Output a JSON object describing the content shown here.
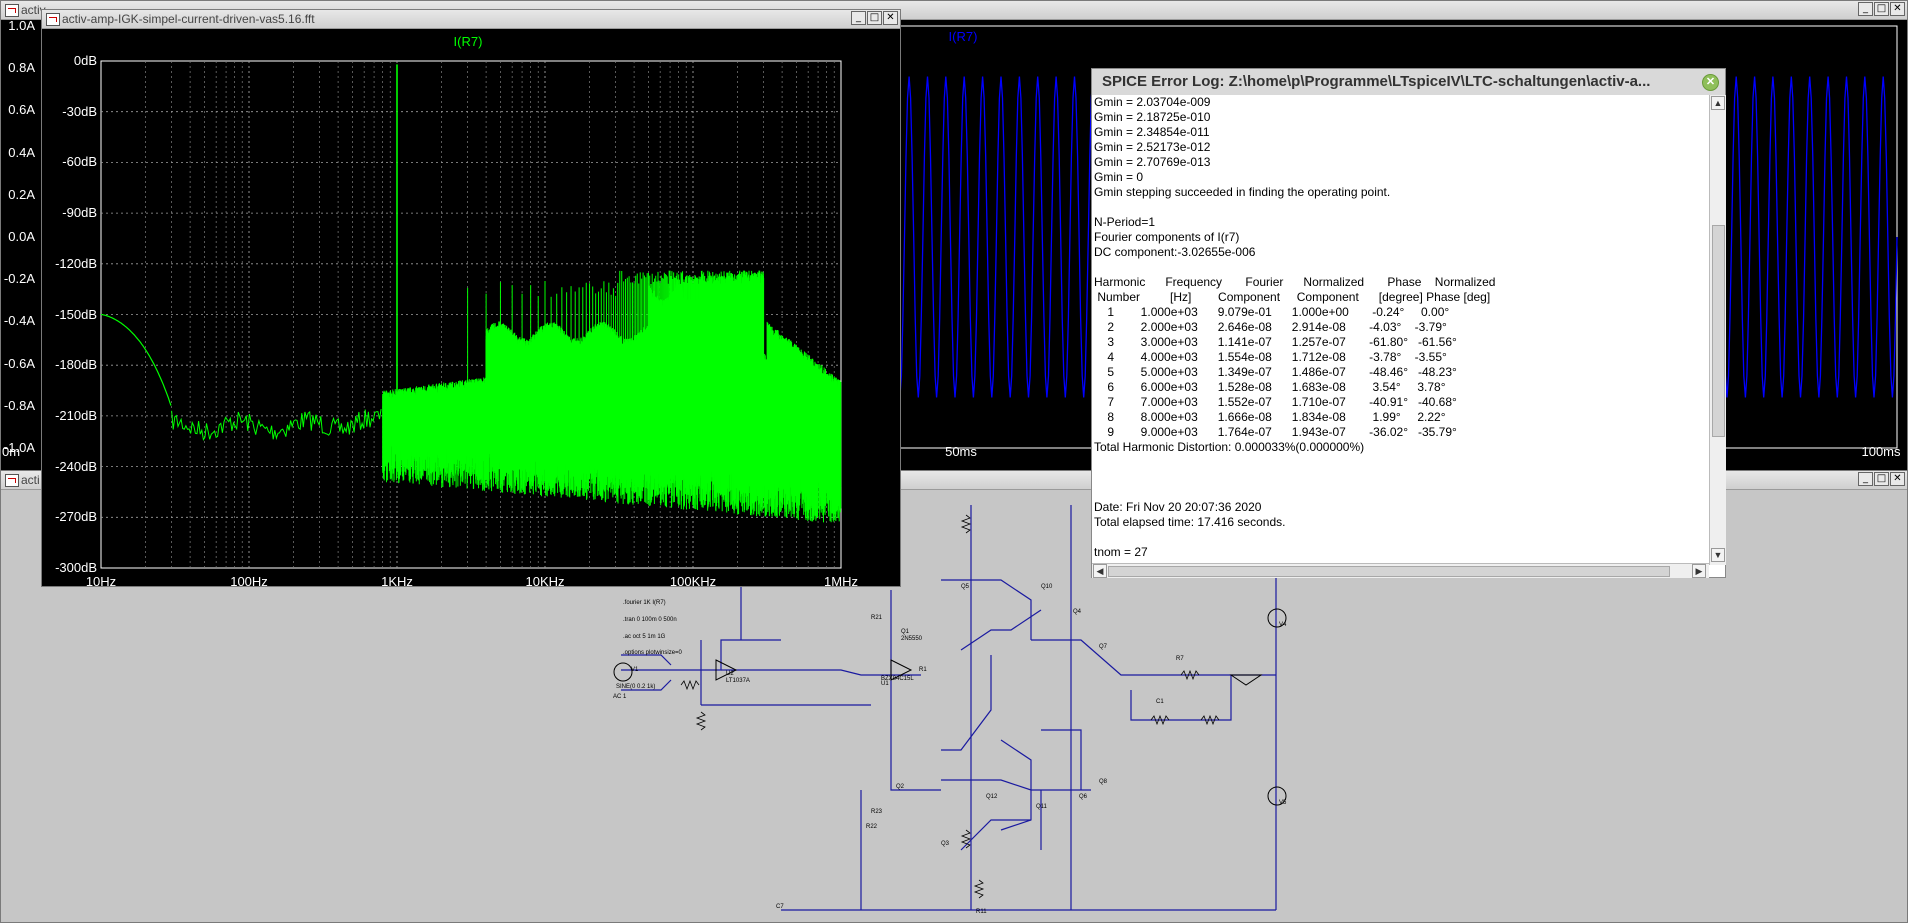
{
  "fft_window": {
    "title": "activ-amp-IGK-simpel-current-driven-vas5.16.fft",
    "trace_label": "I(R7)",
    "y_ticks": [
      "0dB",
      "-30dB",
      "-60dB",
      "-90dB",
      "-120dB",
      "-150dB",
      "-180dB",
      "-210dB",
      "-240dB",
      "-270dB",
      "-300dB"
    ],
    "x_ticks": [
      "10Hz",
      "100Hz",
      "1KHz",
      "10KHz",
      "100KHz",
      "1MHz"
    ],
    "trace_color": "#00ff00"
  },
  "time_window": {
    "title_fragment": "activ",
    "trace_label": "I(R7)",
    "y_ticks": [
      "1.0A",
      "0.8A",
      "0.6A",
      "0.4A",
      "0.2A",
      "0.0A",
      "-0.2A",
      "-0.4A",
      "-0.6A",
      "-0.8A",
      "-1.0A"
    ],
    "x_tick_start": "0m",
    "x_tick_mid": "50ms",
    "x_tick_end": "100ms",
    "trace_color": "#0000ff"
  },
  "schematic_window": {
    "title_fragment": "acti",
    "directives": [
      ".fourier 1K I(R7)",
      ".tran 0 100m 0 500n",
      ".ac oct 5 1m 1G",
      ".options plotwinsize=0"
    ],
    "parts": [
      "R21",
      "Q1",
      "2N5550",
      "R1",
      "R23",
      "U2",
      "LT1037A",
      "U1",
      "BZX84C15L",
      "V4",
      "V5",
      "Q5",
      "Q10",
      "Q4",
      "Q7",
      "R7",
      "C1",
      "Q2",
      "Q12",
      "Q3",
      "Q11",
      "Q6",
      "Q8",
      "R22",
      "R11",
      "C7",
      "V1",
      "SINE(0 0.2 1k)",
      "AC 1"
    ]
  },
  "error_log": {
    "title": "SPICE Error Log: Z:\\home\\p\\Programme\\LTspiceIV\\LTC-schaltungen\\activ-a...",
    "lines": [
      "Gmin = 2.03704e-009",
      "Gmin = 2.18725e-010",
      "Gmin = 2.34854e-011",
      "Gmin = 2.52173e-012",
      "Gmin = 2.70769e-013",
      "Gmin = 0",
      "Gmin stepping succeeded in finding the operating point.",
      "",
      "N-Period=1",
      "Fourier components of I(r7)",
      "DC component:-3.02655e-006",
      "",
      "Harmonic      Frequency       Fourier      Normalized       Phase    Normalized",
      " Number         [Hz]        Component     Component      [degree] Phase [deg]",
      "    1        1.000e+03      9.079e-01      1.000e+00       -0.24°     0.00°",
      "    2        2.000e+03      2.646e-08      2.914e-08       -4.03°    -3.79°",
      "    3        3.000e+03      1.141e-07      1.257e-07       -61.80°   -61.56°",
      "    4        4.000e+03      1.554e-08      1.712e-08       -3.78°    -3.55°",
      "    5        5.000e+03      1.349e-07      1.486e-07       -48.46°   -48.23°",
      "    6        6.000e+03      1.528e-08      1.683e-08        3.54°     3.78°",
      "    7        7.000e+03      1.552e-07      1.710e-07       -40.91°   -40.68°",
      "    8        8.000e+03      1.666e-08      1.834e-08        1.99°     2.22°",
      "    9        9.000e+03      1.764e-07      1.943e-07       -36.02°   -35.79°",
      "Total Harmonic Distortion: 0.000033%(0.000000%)",
      "",
      "",
      "",
      "Date: Fri Nov 20 20:07:36 2020",
      "Total elapsed time: 17.416 seconds.",
      "",
      "tnom = 27"
    ]
  },
  "window_buttons": {
    "minimize": "_",
    "maximize": "□",
    "close": "✕"
  },
  "icons": {
    "close_circle": "close-circle-icon",
    "scroll_up": "▲",
    "scroll_down": "▼",
    "scroll_left": "◀",
    "scroll_right": "▶"
  }
}
